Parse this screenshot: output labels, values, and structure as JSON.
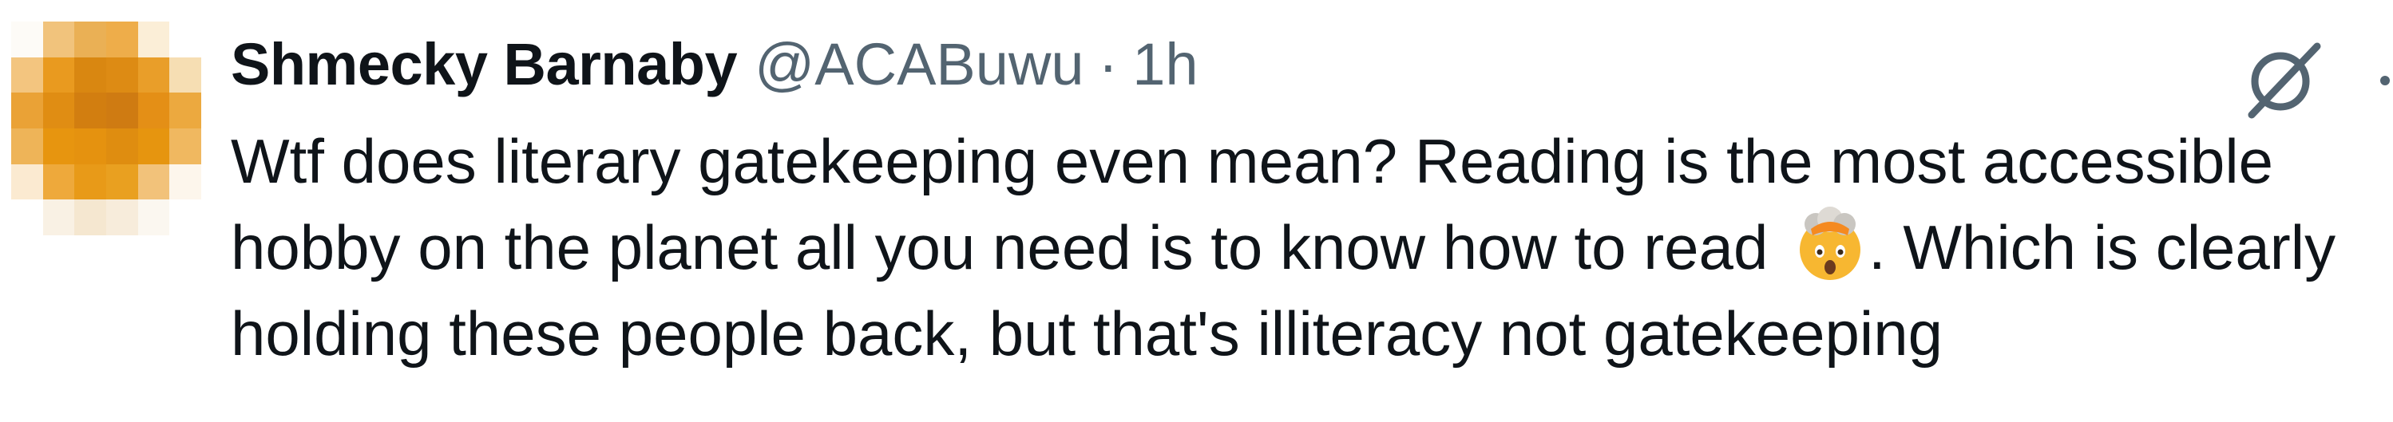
{
  "tweet": {
    "author_name": "Shmecky Barnaby",
    "author_handle": "@ACABuwu",
    "separator": "·",
    "time": "1h",
    "text_part1": "Wtf does literary gatekeeping even mean? Reading is the most accessible hobby on the planet all you need is to know how to read",
    "emoji": "🤯",
    "text_part2": ". Which is clearly holding these people back, but that's illiteracy not gatekeeping"
  },
  "icons": {
    "avatar": "pixelated-avatar",
    "grok": "grok-slash-icon",
    "more": "more-options-icon"
  },
  "colors": {
    "text": "#0f1419",
    "secondary": "#536471",
    "avatar_primary": "#e59413"
  }
}
